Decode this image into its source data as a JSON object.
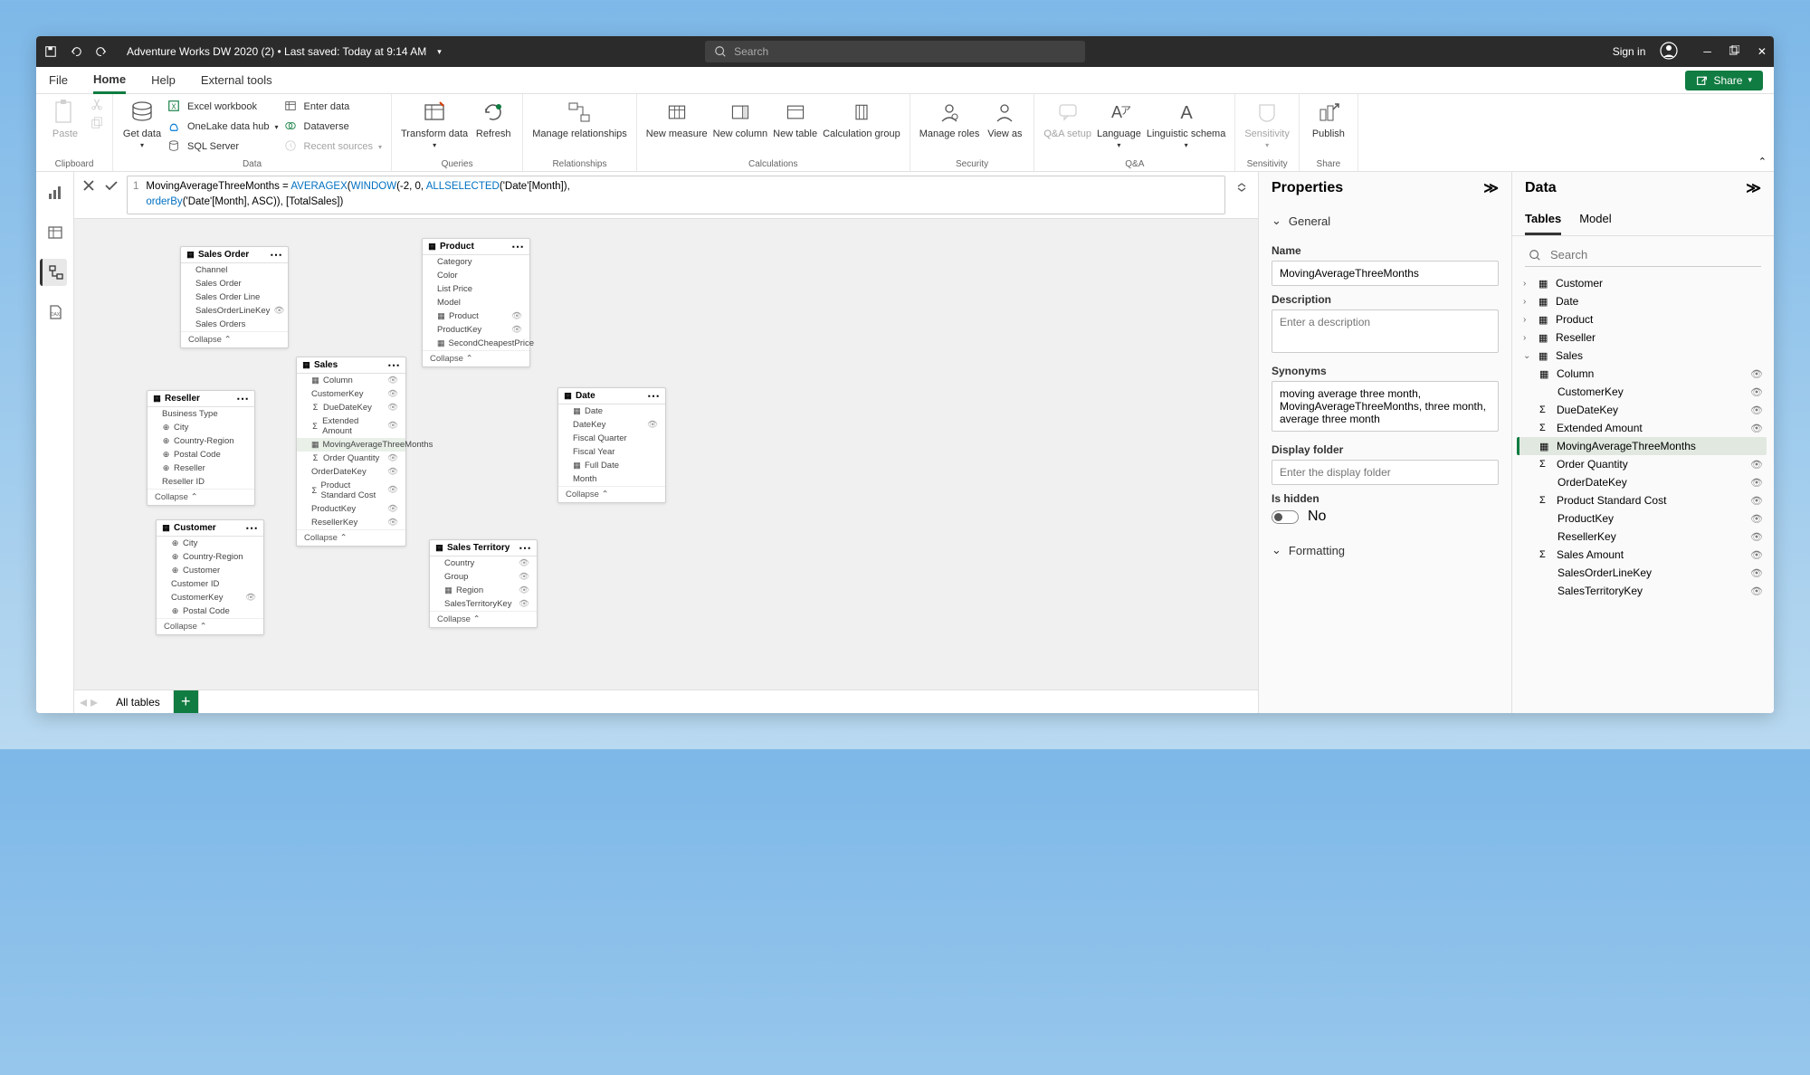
{
  "titlebar": {
    "title": "Adventure Works DW 2020 (2)  •  Last saved: Today at 9:14 AM",
    "searchPlaceholder": "Search",
    "signIn": "Sign in"
  },
  "tabs": {
    "file": "File",
    "home": "Home",
    "help": "Help",
    "external": "External tools",
    "share": "Share"
  },
  "ribbon": {
    "groups": {
      "clipboard": "Clipboard",
      "data": "Data",
      "queries": "Queries",
      "relationships": "Relationships",
      "calculations": "Calculations",
      "security": "Security",
      "qna": "Q&A",
      "sensitivity": "Sensitivity",
      "share": "Share"
    },
    "paste": "Paste",
    "getData": "Get data",
    "excelWorkbook": "Excel workbook",
    "onelake": "OneLake data hub",
    "sqlServer": "SQL Server",
    "enterData": "Enter data",
    "dataverse": "Dataverse",
    "recentSources": "Recent sources",
    "transformData": "Transform data",
    "refresh": "Refresh",
    "manageRel": "Manage relationships",
    "newMeasure": "New measure",
    "newColumn": "New column",
    "newTable": "New table",
    "calcGroup": "Calculation group",
    "manageRoles": "Manage roles",
    "viewAs": "View as",
    "qnaSetup": "Q&A setup",
    "language": "Language",
    "linguisticSchema": "Linguistic schema",
    "sensitivityBtn": "Sensitivity",
    "publish": "Publish"
  },
  "formula": {
    "lineNum": "1",
    "name": "MovingAverageThreeMonths",
    "eq": " = ",
    "fn1": "AVERAGEX",
    "open1": "(",
    "fn2": "WINDOW",
    "args2": "(-2, 0, ",
    "fn3": "ALLSELECTED",
    "args3": "('Date'[Month]), ",
    "fn4": "orderBy",
    "args4": "('Date'[Month], ASC)), [TotalSales])"
  },
  "modelTables": {
    "salesOrder": {
      "title": "Sales Order",
      "fields": [
        "Channel",
        "Sales Order",
        "Sales Order Line",
        "SalesOrderLineKey",
        "Sales Orders"
      ],
      "collapse": "Collapse"
    },
    "product": {
      "title": "Product",
      "fields": [
        "Category",
        "Color",
        "List Price",
        "Model",
        "Product",
        "ProductKey",
        "SecondCheapestPrice"
      ],
      "collapse": "Collapse"
    },
    "reseller": {
      "title": "Reseller",
      "fields": [
        "Business Type",
        "City",
        "Country-Region",
        "Postal Code",
        "Reseller",
        "Reseller ID"
      ],
      "collapse": "Collapse"
    },
    "sales": {
      "title": "Sales",
      "fields": [
        "Column",
        "CustomerKey",
        "DueDateKey",
        "Extended Amount",
        "MovingAverageThreeMonths",
        "Order Quantity",
        "OrderDateKey",
        "Product Standard Cost",
        "ProductKey",
        "ResellerKey"
      ],
      "collapse": "Collapse"
    },
    "date": {
      "title": "Date",
      "fields": [
        "Date",
        "DateKey",
        "Fiscal Quarter",
        "Fiscal Year",
        "Full Date",
        "Month"
      ],
      "collapse": "Collapse"
    },
    "customer": {
      "title": "Customer",
      "fields": [
        "City",
        "Country-Region",
        "Customer",
        "Customer ID",
        "CustomerKey",
        "Postal Code"
      ],
      "collapse": "Collapse"
    },
    "salesTerritory": {
      "title": "Sales Territory",
      "fields": [
        "Country",
        "Group",
        "Region",
        "SalesTerritoryKey"
      ],
      "collapse": "Collapse"
    }
  },
  "canvasTab": {
    "allTables": "All tables"
  },
  "properties": {
    "title": "Properties",
    "general": "General",
    "nameLabel": "Name",
    "nameValue": "MovingAverageThreeMonths",
    "descLabel": "Description",
    "descPlaceholder": "Enter a description",
    "synLabel": "Synonyms",
    "synValue": "moving average three month, MovingAverageThreeMonths, three month, average three month",
    "folderLabel": "Display folder",
    "folderPlaceholder": "Enter the display folder",
    "hiddenLabel": "Is hidden",
    "hiddenValue": "No",
    "formatting": "Formatting"
  },
  "data": {
    "title": "Data",
    "tablesTab": "Tables",
    "modelTab": "Model",
    "searchPlaceholder": "Search",
    "customer": "Customer",
    "date": "Date",
    "product": "Product",
    "reseller": "Reseller",
    "sales": "Sales",
    "salesFields": {
      "column": "Column",
      "customerKey": "CustomerKey",
      "dueDateKey": "DueDateKey",
      "extendedAmount": "Extended Amount",
      "movingAverage": "MovingAverageThreeMonths",
      "orderQuantity": "Order Quantity",
      "orderDateKey": "OrderDateKey",
      "productStdCost": "Product Standard Cost",
      "productKey": "ProductKey",
      "resellerKey": "ResellerKey",
      "salesAmount": "Sales Amount",
      "salesOrderLineKey": "SalesOrderLineKey",
      "salesTerritoryKey": "SalesTerritoryKey"
    }
  }
}
